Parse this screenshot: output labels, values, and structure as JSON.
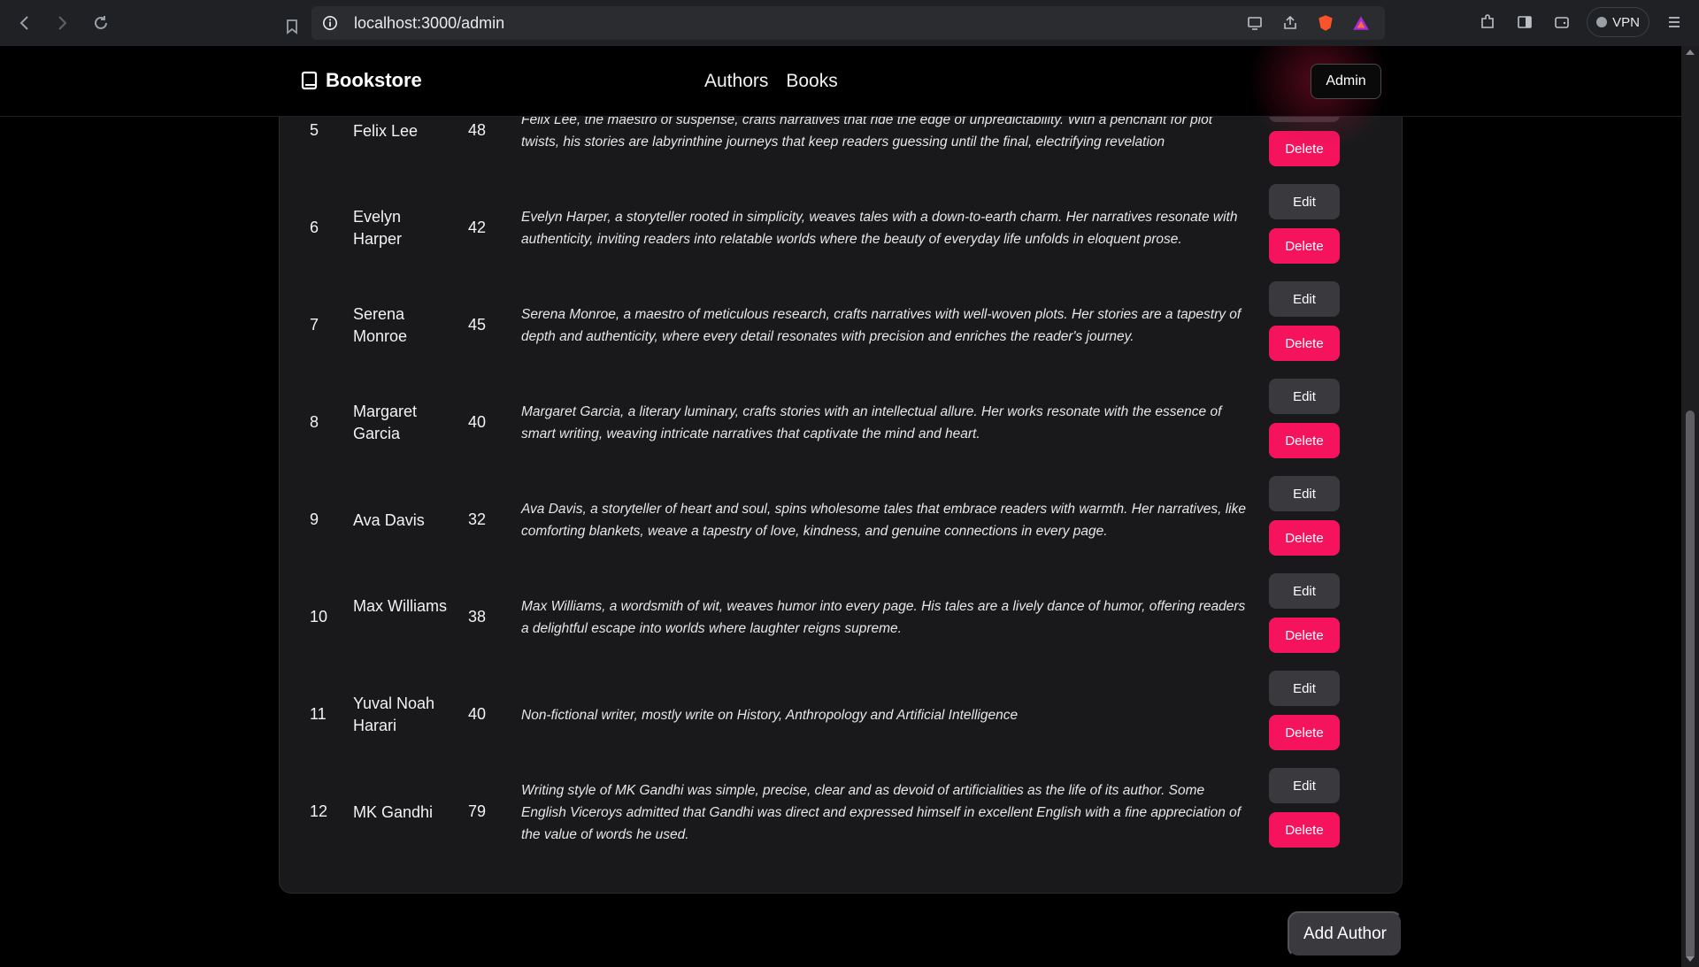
{
  "browser": {
    "url": "localhost:3000/admin",
    "vpn_label": "VPN"
  },
  "site": {
    "brand": "Bookstore",
    "nav": [
      "Authors",
      "Books"
    ],
    "admin_label": "Admin"
  },
  "authors": [
    {
      "id": "5",
      "name": "Felix Lee",
      "age": "48",
      "bio": "Felix Lee, the maestro of suspense, crafts narratives that ride the edge of unpredictability. With a penchant for plot twists, his stories are labyrinthine journeys that keep readers guessing until the final, electrifying revelation"
    },
    {
      "id": "6",
      "name": "Evelyn Harper",
      "age": "42",
      "bio": "Evelyn Harper, a storyteller rooted in simplicity, weaves tales with a down-to-earth charm. Her narratives resonate with authenticity, inviting readers into relatable worlds where the beauty of everyday life unfolds in eloquent prose."
    },
    {
      "id": "7",
      "name": "Serena Monroe",
      "age": "45",
      "bio": "Serena Monroe, a maestro of meticulous research, crafts narratives with well-woven plots. Her stories are a tapestry of depth and authenticity, where every detail resonates with precision and enriches the reader's journey."
    },
    {
      "id": "8",
      "name": "Margaret Garcia",
      "age": "40",
      "bio": "Margaret Garcia, a literary luminary, crafts stories with an intellectual allure. Her works resonate with the essence of smart writing, weaving intricate narratives that captivate the mind and heart."
    },
    {
      "id": "9",
      "name": "Ava Davis",
      "age": "32",
      "bio": "Ava Davis, a storyteller of heart and soul, spins wholesome tales that embrace readers with warmth. Her narratives, like comforting blankets, weave a tapestry of love, kindness, and genuine connections in every page."
    },
    {
      "id": "10",
      "name": "Max Williams",
      "age": "38",
      "bio": "Max Williams, a wordsmith of wit, weaves humor into every page. His tales are a lively dance of humor, offering readers a delightful escape into worlds where laughter reigns supreme."
    },
    {
      "id": "11",
      "name": "Yuval Noah Harari",
      "age": "40",
      "bio": "Non-fictional writer, mostly write on History, Anthropology and Artificial Intelligence"
    },
    {
      "id": "12",
      "name": "MK Gandhi",
      "age": "79",
      "bio": "Writing style of MK Gandhi was simple, precise, clear and as devoid of artificialities as the life of its author. Some English Viceroys admitted that Gandhi was direct and expressed himself in excellent English with a fine appreciation of the value of words he used."
    }
  ],
  "actions": {
    "edit_label": "Edit",
    "delete_label": "Delete",
    "add_author_label": "Add Author"
  },
  "colors": {
    "delete": "#f5135e",
    "edit": "#3a3a3e",
    "card": "#19191b"
  }
}
